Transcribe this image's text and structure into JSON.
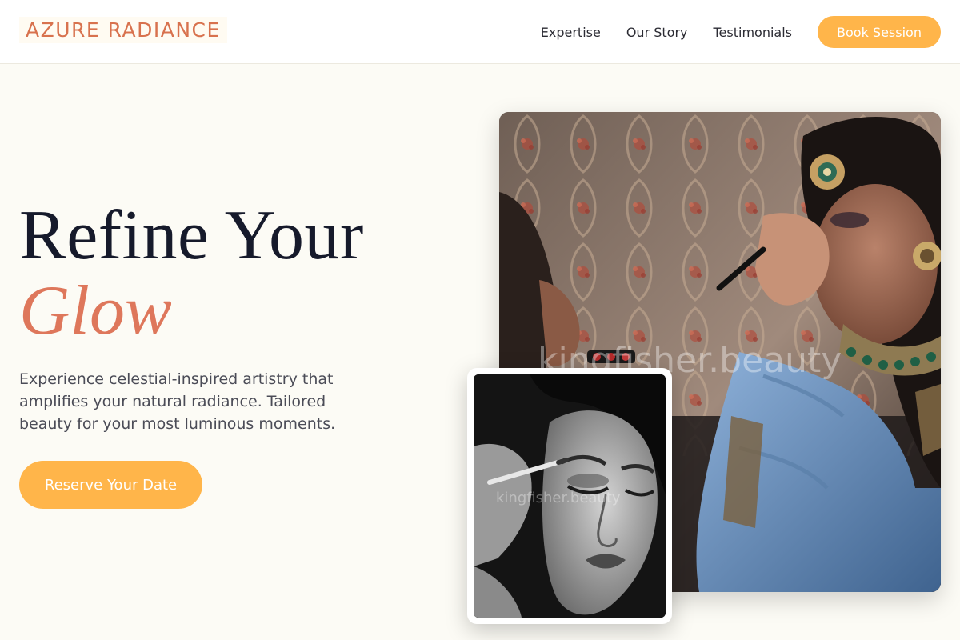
{
  "brand": {
    "name": "AZURE RADIANCE"
  },
  "nav": {
    "links": [
      "Expertise",
      "Our Story",
      "Testimonials"
    ],
    "cta": "Book Session"
  },
  "hero": {
    "title_line1": "Refine Your",
    "title_line2": "Glow",
    "description": "Experience celestial-inspired artistry that amplifies your natural radiance. Tailored beauty for your most luminous moments.",
    "cta": "Reserve Your Date"
  },
  "images": {
    "main_watermark": "kingfisher.beauty",
    "inset_watermark": "kingfisher.beauty"
  },
  "colors": {
    "accent": "#ffb54a",
    "brand": "#d8724e",
    "title_dark": "#161a2b",
    "title_italic": "#de775b",
    "background": "#fcfbf5"
  }
}
